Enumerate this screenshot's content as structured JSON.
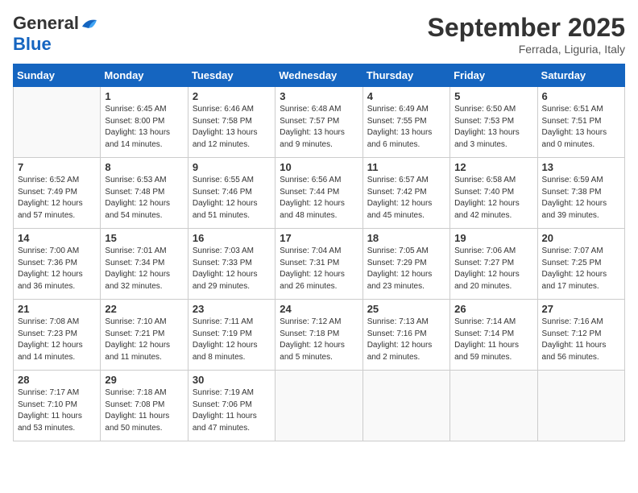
{
  "logo": {
    "line1": "General",
    "line2": "Blue"
  },
  "title": "September 2025",
  "subtitle": "Ferrada, Liguria, Italy",
  "days": [
    "Sunday",
    "Monday",
    "Tuesday",
    "Wednesday",
    "Thursday",
    "Friday",
    "Saturday"
  ],
  "weeks": [
    [
      {
        "day": "",
        "info": ""
      },
      {
        "day": "1",
        "info": "Sunrise: 6:45 AM\nSunset: 8:00 PM\nDaylight: 13 hours\nand 14 minutes."
      },
      {
        "day": "2",
        "info": "Sunrise: 6:46 AM\nSunset: 7:58 PM\nDaylight: 13 hours\nand 12 minutes."
      },
      {
        "day": "3",
        "info": "Sunrise: 6:48 AM\nSunset: 7:57 PM\nDaylight: 13 hours\nand 9 minutes."
      },
      {
        "day": "4",
        "info": "Sunrise: 6:49 AM\nSunset: 7:55 PM\nDaylight: 13 hours\nand 6 minutes."
      },
      {
        "day": "5",
        "info": "Sunrise: 6:50 AM\nSunset: 7:53 PM\nDaylight: 13 hours\nand 3 minutes."
      },
      {
        "day": "6",
        "info": "Sunrise: 6:51 AM\nSunset: 7:51 PM\nDaylight: 13 hours\nand 0 minutes."
      }
    ],
    [
      {
        "day": "7",
        "info": "Sunrise: 6:52 AM\nSunset: 7:49 PM\nDaylight: 12 hours\nand 57 minutes."
      },
      {
        "day": "8",
        "info": "Sunrise: 6:53 AM\nSunset: 7:48 PM\nDaylight: 12 hours\nand 54 minutes."
      },
      {
        "day": "9",
        "info": "Sunrise: 6:55 AM\nSunset: 7:46 PM\nDaylight: 12 hours\nand 51 minutes."
      },
      {
        "day": "10",
        "info": "Sunrise: 6:56 AM\nSunset: 7:44 PM\nDaylight: 12 hours\nand 48 minutes."
      },
      {
        "day": "11",
        "info": "Sunrise: 6:57 AM\nSunset: 7:42 PM\nDaylight: 12 hours\nand 45 minutes."
      },
      {
        "day": "12",
        "info": "Sunrise: 6:58 AM\nSunset: 7:40 PM\nDaylight: 12 hours\nand 42 minutes."
      },
      {
        "day": "13",
        "info": "Sunrise: 6:59 AM\nSunset: 7:38 PM\nDaylight: 12 hours\nand 39 minutes."
      }
    ],
    [
      {
        "day": "14",
        "info": "Sunrise: 7:00 AM\nSunset: 7:36 PM\nDaylight: 12 hours\nand 36 minutes."
      },
      {
        "day": "15",
        "info": "Sunrise: 7:01 AM\nSunset: 7:34 PM\nDaylight: 12 hours\nand 32 minutes."
      },
      {
        "day": "16",
        "info": "Sunrise: 7:03 AM\nSunset: 7:33 PM\nDaylight: 12 hours\nand 29 minutes."
      },
      {
        "day": "17",
        "info": "Sunrise: 7:04 AM\nSunset: 7:31 PM\nDaylight: 12 hours\nand 26 minutes."
      },
      {
        "day": "18",
        "info": "Sunrise: 7:05 AM\nSunset: 7:29 PM\nDaylight: 12 hours\nand 23 minutes."
      },
      {
        "day": "19",
        "info": "Sunrise: 7:06 AM\nSunset: 7:27 PM\nDaylight: 12 hours\nand 20 minutes."
      },
      {
        "day": "20",
        "info": "Sunrise: 7:07 AM\nSunset: 7:25 PM\nDaylight: 12 hours\nand 17 minutes."
      }
    ],
    [
      {
        "day": "21",
        "info": "Sunrise: 7:08 AM\nSunset: 7:23 PM\nDaylight: 12 hours\nand 14 minutes."
      },
      {
        "day": "22",
        "info": "Sunrise: 7:10 AM\nSunset: 7:21 PM\nDaylight: 12 hours\nand 11 minutes."
      },
      {
        "day": "23",
        "info": "Sunrise: 7:11 AM\nSunset: 7:19 PM\nDaylight: 12 hours\nand 8 minutes."
      },
      {
        "day": "24",
        "info": "Sunrise: 7:12 AM\nSunset: 7:18 PM\nDaylight: 12 hours\nand 5 minutes."
      },
      {
        "day": "25",
        "info": "Sunrise: 7:13 AM\nSunset: 7:16 PM\nDaylight: 12 hours\nand 2 minutes."
      },
      {
        "day": "26",
        "info": "Sunrise: 7:14 AM\nSunset: 7:14 PM\nDaylight: 11 hours\nand 59 minutes."
      },
      {
        "day": "27",
        "info": "Sunrise: 7:16 AM\nSunset: 7:12 PM\nDaylight: 11 hours\nand 56 minutes."
      }
    ],
    [
      {
        "day": "28",
        "info": "Sunrise: 7:17 AM\nSunset: 7:10 PM\nDaylight: 11 hours\nand 53 minutes."
      },
      {
        "day": "29",
        "info": "Sunrise: 7:18 AM\nSunset: 7:08 PM\nDaylight: 11 hours\nand 50 minutes."
      },
      {
        "day": "30",
        "info": "Sunrise: 7:19 AM\nSunset: 7:06 PM\nDaylight: 11 hours\nand 47 minutes."
      },
      {
        "day": "",
        "info": ""
      },
      {
        "day": "",
        "info": ""
      },
      {
        "day": "",
        "info": ""
      },
      {
        "day": "",
        "info": ""
      }
    ]
  ]
}
